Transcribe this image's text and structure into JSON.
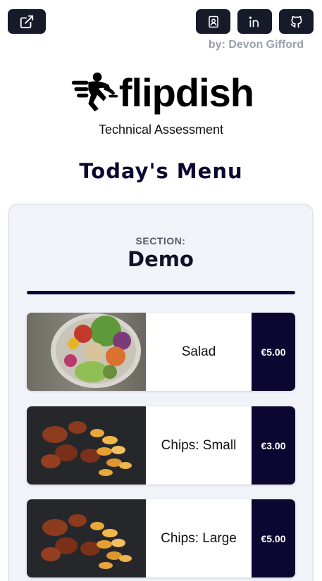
{
  "header": {
    "byline": "by: Devon Gifford",
    "buttons": [
      {
        "icon": "external-link-icon"
      },
      {
        "icon": "contact-icon"
      },
      {
        "icon": "linkedin-icon"
      },
      {
        "icon": "github-icon"
      }
    ]
  },
  "brand": {
    "logo_text": "flipdish",
    "subtitle": "Technical Assessment"
  },
  "page_title": "Today's Menu",
  "section": {
    "label": "SECTION:",
    "name": "Demo",
    "items": [
      {
        "name": "Salad",
        "price": "€5.00",
        "image": "salad-bowl"
      },
      {
        "name": "Chips: Small",
        "price": "€3.00",
        "image": "wings-and-chips"
      },
      {
        "name": "Chips: Large",
        "price": "€5.00",
        "image": "wings-and-chips"
      }
    ]
  },
  "colors": {
    "navy": "#0b0730",
    "button_bg": "#161a29",
    "card_bg": "#f0f3f8"
  }
}
